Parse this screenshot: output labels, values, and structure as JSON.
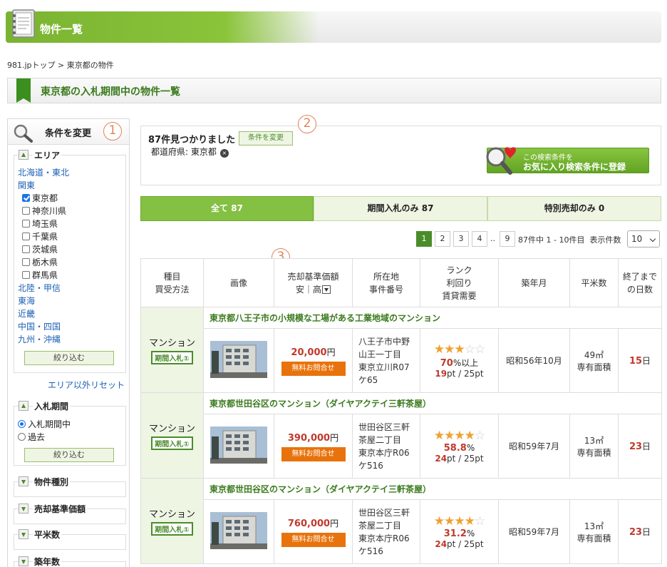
{
  "header": {
    "title": "物件一覧"
  },
  "breadcrumb": {
    "home": "981.jpトップ",
    "sep": ">",
    "current": "東京都の物件"
  },
  "section": {
    "title": "東京都の入札期間中の物件一覧"
  },
  "sidebar": {
    "title": "条件を変更",
    "step_number": "1",
    "area": {
      "title": "エリア",
      "regions_top": [
        "北海道・東北",
        "関東"
      ],
      "prefectures": [
        {
          "label": "東京都",
          "checked": true
        },
        {
          "label": "神奈川県",
          "checked": false
        },
        {
          "label": "埼玉県",
          "checked": false
        },
        {
          "label": "千葉県",
          "checked": false
        },
        {
          "label": "茨城県",
          "checked": false
        },
        {
          "label": "栃木県",
          "checked": false
        },
        {
          "label": "群馬県",
          "checked": false
        }
      ],
      "regions_bottom": [
        "北陸・甲信",
        "東海",
        "近畿",
        "中国・四国",
        "九州・沖縄"
      ],
      "narrow_label": "絞り込む",
      "reset_label": "エリア以外リセット"
    },
    "bid_period": {
      "title": "入札期間",
      "options": [
        {
          "label": "入札期間中",
          "checked": true
        },
        {
          "label": "過去",
          "checked": false
        }
      ],
      "narrow_label": "絞り込む"
    },
    "collapsed_filters": [
      "物件種別",
      "売却基準価額",
      "平米数",
      "築年数"
    ]
  },
  "results": {
    "count_text": "87件見つかりました",
    "change_label": "条件を変更",
    "step_number": "2",
    "pref_filter": "都道府県: 東京都",
    "remove_icon": "×",
    "fav_line1": "この検索条件を",
    "fav_line2": "お気に入り検索条件に登録"
  },
  "tabs": [
    {
      "label": "全て 87",
      "active": true
    },
    {
      "label": "期間入札のみ 87",
      "active": false
    },
    {
      "label": "特別売却のみ 0",
      "active": false
    }
  ],
  "pager": {
    "pages": [
      "1",
      "2",
      "3",
      "4"
    ],
    "dots": "..",
    "last": "9",
    "info": "87件中 1 - 10件目",
    "per_page_label": "表示件数",
    "per_page_value": "10"
  },
  "table": {
    "step_number": "3",
    "headers": {
      "type_l1": "種目",
      "type_l2": "買受方法",
      "image": "画像",
      "price_l1": "売却基準価額",
      "price_l2": "安｜高",
      "loc_l1": "所在地",
      "loc_l2": "事件番号",
      "rank_l1": "ランク",
      "rank_l2": "利回り",
      "rank_l3": "賃貸需要",
      "built": "築年月",
      "area": "平米数",
      "days_l1": "終了まで",
      "days_l2": "の日数"
    },
    "rows": [
      {
        "title": "東京都八王子市の小規模な工場がある工業地域のマンション",
        "type": "マンション",
        "method": "期間入札①",
        "price": "20,000",
        "unit": "円",
        "inquiry": "無料お問合せ",
        "addr1": "八王子市中野",
        "addr2": "山王一丁目",
        "addr3": "東京立川R07",
        "addr4": "ケ65",
        "stars": 3,
        "yield": "70",
        "yield_suffix": "%以上",
        "rent_pt": "19",
        "rent_rest": "pt / 25pt",
        "built": "昭和56年10月",
        "area": "49㎡",
        "area_note": "専有面積",
        "days": "15",
        "days_unit": "日"
      },
      {
        "title": "東京都世田谷区のマンション（ダイヤアクテイ三軒茶屋）",
        "type": "マンション",
        "method": "期間入札①",
        "price": "390,000",
        "unit": "円",
        "inquiry": "無料お問合せ",
        "addr1": "世田谷区三軒",
        "addr2": "茶屋二丁目",
        "addr3": "東京本庁R06",
        "addr4": "ケ516",
        "stars": 4,
        "yield": "58.8",
        "yield_suffix": "%",
        "rent_pt": "24",
        "rent_rest": "pt / 25pt",
        "built": "昭和59年7月",
        "area": "13㎡",
        "area_note": "専有面積",
        "days": "23",
        "days_unit": "日"
      },
      {
        "title": "東京都世田谷区のマンション（ダイヤアクテイ三軒茶屋）",
        "type": "マンション",
        "method": "期間入札①",
        "price": "760,000",
        "unit": "円",
        "inquiry": "無料お問合せ",
        "addr1": "世田谷区三軒",
        "addr2": "茶屋二丁目",
        "addr3": "東京本庁R06",
        "addr4": "ケ516",
        "stars": 4,
        "yield": "31.2",
        "yield_suffix": "%",
        "rent_pt": "24",
        "rent_rest": "pt / 25pt",
        "built": "昭和59年7月",
        "area": "13㎡",
        "area_note": "専有面積",
        "days": "23",
        "days_unit": "日"
      }
    ]
  },
  "colors": {
    "green": "#84c042",
    "dark_green": "#4a8c2a",
    "red": "#c0392b",
    "orange": "#e8730c",
    "link": "#1a5fb4"
  }
}
